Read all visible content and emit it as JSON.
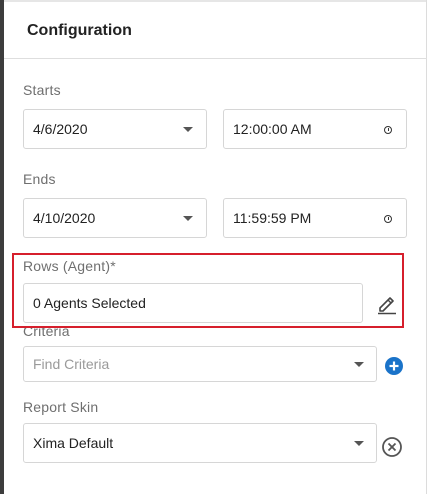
{
  "header": {
    "title": "Configuration"
  },
  "starts": {
    "label": "Starts",
    "date": "4/6/2020",
    "time": "12:00:00 AM"
  },
  "ends": {
    "label": "Ends",
    "date": "4/10/2020",
    "time": "11:59:59 PM"
  },
  "rows": {
    "label": "Rows (Agent)*",
    "value": "0 Agents Selected"
  },
  "criteria": {
    "label": "Criteria",
    "placeholder": "Find Criteria"
  },
  "report_skin": {
    "label": "Report Skin",
    "value": "Xima Default"
  },
  "icons": {
    "edit": "pencil-icon",
    "add": "plus-circle-icon",
    "clear": "close-circle-icon",
    "dropdown": "chevron-down-icon",
    "time": "clock-icon"
  },
  "colors": {
    "highlight": "#d61f2c",
    "add_button": "#1a73c9"
  }
}
